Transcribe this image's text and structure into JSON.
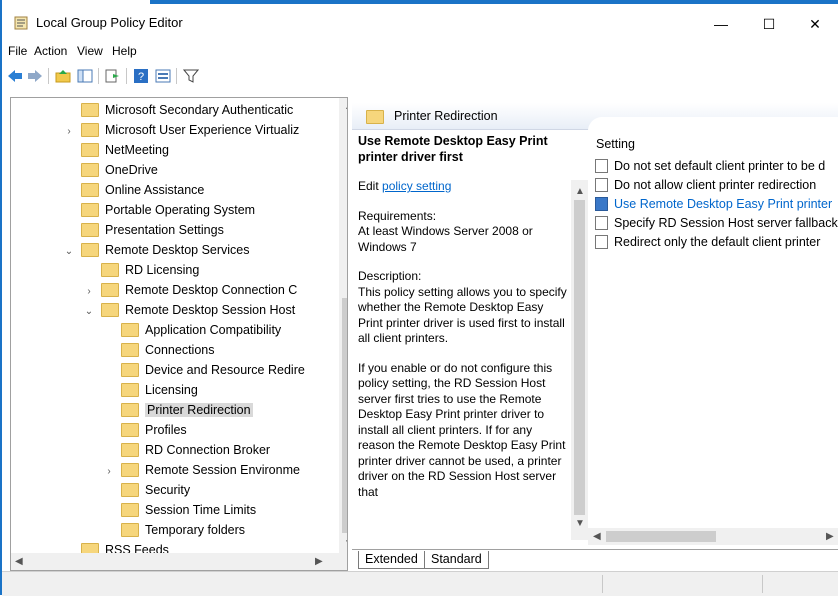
{
  "window": {
    "title": "Local Group Policy Editor",
    "minimize": "—",
    "maximize": "☐",
    "close": "✕"
  },
  "menu": [
    "File",
    "Action",
    "View",
    "Help"
  ],
  "toolbar": {
    "icons": [
      "back-icon",
      "forward-icon",
      "up-folder-icon",
      "show-hide-tree-icon",
      "export-list-icon",
      "help-icon",
      "properties-icon",
      "filter-icon"
    ]
  },
  "tree": {
    "items": [
      {
        "label": "Microsoft Secondary Authenticatic",
        "indent": 1,
        "expander": ""
      },
      {
        "label": "Microsoft User Experience Virtualiz",
        "indent": 1,
        "expander": ">"
      },
      {
        "label": "NetMeeting",
        "indent": 1,
        "expander": ""
      },
      {
        "label": "OneDrive",
        "indent": 1,
        "expander": ""
      },
      {
        "label": "Online Assistance",
        "indent": 1,
        "expander": ""
      },
      {
        "label": "Portable Operating System",
        "indent": 1,
        "expander": ""
      },
      {
        "label": "Presentation Settings",
        "indent": 1,
        "expander": ""
      },
      {
        "label": "Remote Desktop Services",
        "indent": 1,
        "expander": "v"
      },
      {
        "label": "RD Licensing",
        "indent": 2,
        "expander": ""
      },
      {
        "label": "Remote Desktop Connection C",
        "indent": 2,
        "expander": ">"
      },
      {
        "label": "Remote Desktop Session Host",
        "indent": 2,
        "expander": "v"
      },
      {
        "label": "Application Compatibility",
        "indent": 3,
        "expander": ""
      },
      {
        "label": "Connections",
        "indent": 3,
        "expander": ""
      },
      {
        "label": "Device and Resource Redire",
        "indent": 3,
        "expander": ""
      },
      {
        "label": "Licensing",
        "indent": 3,
        "expander": ""
      },
      {
        "label": "Printer Redirection",
        "indent": 3,
        "expander": "",
        "selected": true
      },
      {
        "label": "Profiles",
        "indent": 3,
        "expander": ""
      },
      {
        "label": "RD Connection Broker",
        "indent": 3,
        "expander": ""
      },
      {
        "label": "Remote Session Environme",
        "indent": 3,
        "expander": ">"
      },
      {
        "label": "Security",
        "indent": 3,
        "expander": ""
      },
      {
        "label": "Session Time Limits",
        "indent": 3,
        "expander": ""
      },
      {
        "label": "Temporary folders",
        "indent": 3,
        "expander": ""
      },
      {
        "label": "RSS Feeds",
        "indent": 1,
        "expander": ""
      }
    ]
  },
  "right": {
    "header": "Printer Redirection",
    "desc": {
      "title": "Use Remote Desktop Easy Print printer driver first",
      "edit_prefix": "Edit ",
      "edit_link": "policy setting",
      "requirements_label": "Requirements:",
      "requirements": "At least Windows Server 2008 or Windows 7",
      "description_label": "Description:",
      "description": "This policy setting allows you to specify whether the Remote Desktop Easy Print printer driver is used first to install all client printers.",
      "more": "If you enable or do not configure this policy setting, the RD Session Host server first tries to use the Remote Desktop Easy Print printer driver to install all client printers. If for any reason the Remote Desktop Easy Print printer driver cannot be used, a printer driver on the RD Session Host server that"
    },
    "list": {
      "column_header": "Setting",
      "rows": [
        {
          "label": "Do not set default client printer to be d",
          "selected": false
        },
        {
          "label": "Do not allow client printer redirection",
          "selected": false
        },
        {
          "label": "Use Remote Desktop Easy Print printer",
          "selected": true
        },
        {
          "label": "Specify RD Session Host server fallback",
          "selected": false
        },
        {
          "label": "Redirect only the default client printer",
          "selected": false
        }
      ]
    },
    "tabs": [
      "Extended",
      "Standard"
    ]
  },
  "colors": {
    "accent": "#1a73c7",
    "link": "#0066cc",
    "folder": "#f6d67c"
  }
}
